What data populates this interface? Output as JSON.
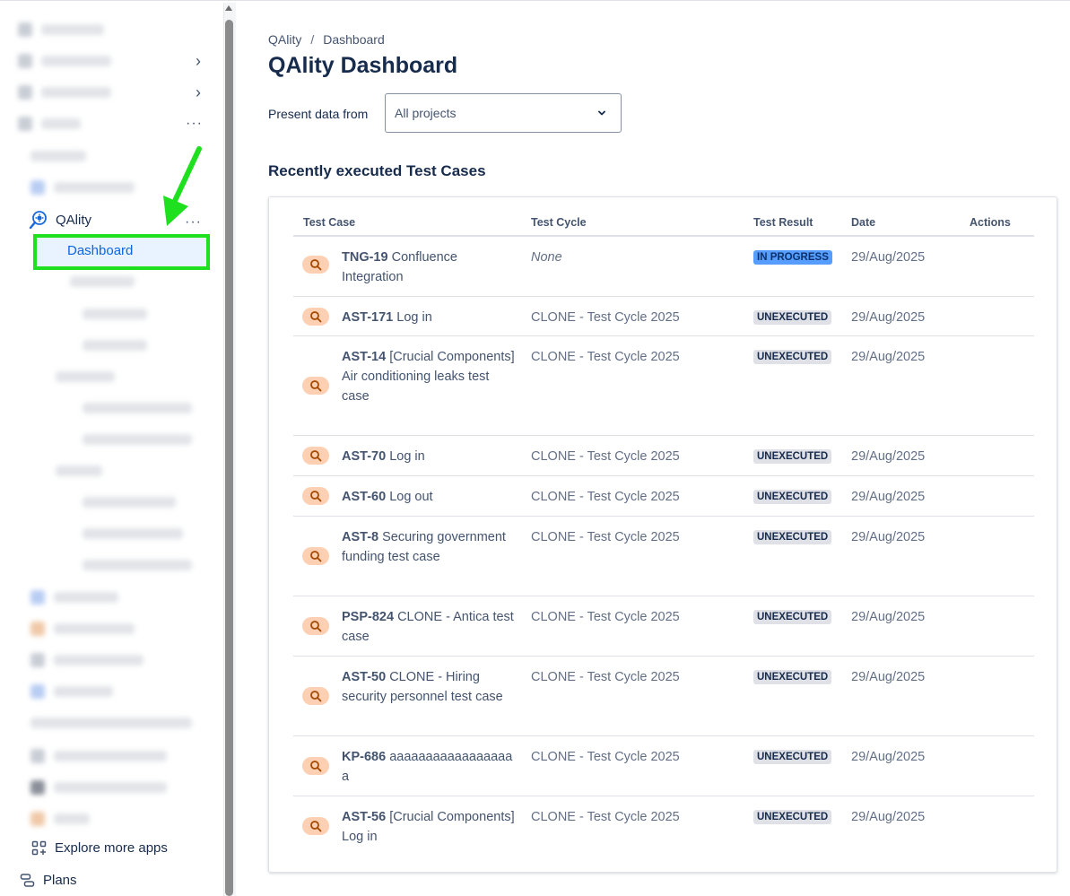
{
  "sidebar": {
    "app_name": "QAlity",
    "active_item": "Dashboard",
    "explore_label": "Explore more apps",
    "plans_label": "Plans"
  },
  "breadcrumb": {
    "root": "QAlity",
    "separator": "/",
    "current": "Dashboard"
  },
  "page": {
    "title": "QAlity Dashboard",
    "filter_label": "Present data from",
    "filter_value": "All projects",
    "section_title": "Recently executed Test Cases"
  },
  "table": {
    "headers": [
      "Test Case",
      "Test Cycle",
      "Test Result",
      "Date",
      "Actions"
    ],
    "rows": [
      {
        "key": "TNG-19",
        "name": "Confluence Integration",
        "cycle": "None",
        "result": "IN PROGRESS",
        "date": "29/Aug/2025"
      },
      {
        "key": "AST-171",
        "name": "Log in",
        "cycle": "CLONE - Test Cycle 2025",
        "result": "UNEXECUTED",
        "date": "29/Aug/2025"
      },
      {
        "key": "AST-14",
        "name": "[Crucial Components] Air conditioning leaks test case",
        "cycle": "CLONE - Test Cycle 2025",
        "result": "UNEXECUTED",
        "date": "29/Aug/2025"
      },
      {
        "key": "AST-70",
        "name": "Log in",
        "cycle": "CLONE - Test Cycle 2025",
        "result": "UNEXECUTED",
        "date": "29/Aug/2025"
      },
      {
        "key": "AST-60",
        "name": "Log out",
        "cycle": "CLONE - Test Cycle 2025",
        "result": "UNEXECUTED",
        "date": "29/Aug/2025"
      },
      {
        "key": "AST-8",
        "name": "Securing government funding test case",
        "cycle": "CLONE - Test Cycle 2025",
        "result": "UNEXECUTED",
        "date": "29/Aug/2025"
      },
      {
        "key": "PSP-824",
        "name": "CLONE - Antica test case",
        "cycle": "CLONE - Test Cycle 2025",
        "result": "UNEXECUTED",
        "date": "29/Aug/2025"
      },
      {
        "key": "AST-50",
        "name": "CLONE - Hiring security personnel test case",
        "cycle": "CLONE - Test Cycle 2025",
        "result": "UNEXECUTED",
        "date": "29/Aug/2025"
      },
      {
        "key": "KP-686",
        "name": "aaaaaaaaaaaaaaaaa a",
        "cycle": "CLONE - Test Cycle 2025",
        "result": "UNEXECUTED",
        "date": "29/Aug/2025"
      },
      {
        "key": "AST-56",
        "name": "[Crucial Components] Log in",
        "cycle": "CLONE - Test Cycle 2025",
        "result": "UNEXECUTED",
        "date": "29/Aug/2025"
      }
    ]
  },
  "icons": {
    "test_case": "magnifier-icon",
    "app": "qality-logo-icon",
    "explore": "apps-grid-icon",
    "plans": "plans-icon",
    "dropdown": "chevron-down-icon"
  },
  "colors": {
    "highlight_border": "#1fe01f",
    "arrow": "#1fe01f",
    "active_text": "#0c66e4",
    "badge_inprogress": "#579dff",
    "badge_unexecuted": "#dfe1e6",
    "test_case_icon_bg": "#fdd0b3"
  }
}
